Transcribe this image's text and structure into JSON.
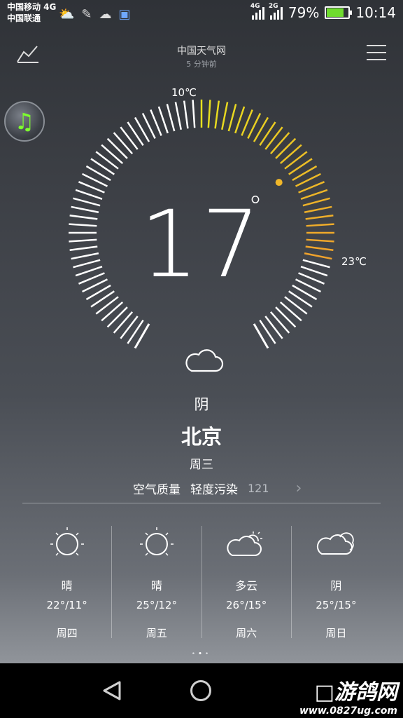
{
  "status_bar": {
    "carrier_1": "中国移动 4G",
    "carrier_2": "中国联通",
    "sig1_label": "4G",
    "sig2_label": "2G",
    "battery_pct": "79%",
    "battery_level": 0.79,
    "time": "10:14"
  },
  "header": {
    "source": "中国天气网",
    "updated": "5 分钟前"
  },
  "current": {
    "temperature": "17",
    "degree_symbol": "°",
    "low_label": "10℃",
    "high_label": "23℃",
    "low": 10,
    "high": 23,
    "condition": "阴",
    "city": "北京",
    "weekday": "周三"
  },
  "air_quality": {
    "label": "空气质量",
    "level": "轻度污染",
    "value": "121",
    "chevron": "›"
  },
  "forecast": [
    {
      "icon": "sun-icon",
      "condition": "晴",
      "range": "22°/11°",
      "day": "周四"
    },
    {
      "icon": "sun-icon",
      "condition": "晴",
      "range": "25°/12°",
      "day": "周五"
    },
    {
      "icon": "partly-cloudy-icon",
      "condition": "多云",
      "range": "26°/15°",
      "day": "周六"
    },
    {
      "icon": "cloud-icon",
      "condition": "阴",
      "range": "25°/15°",
      "day": "周日"
    }
  ],
  "watermark": {
    "title": "□游鸽网",
    "url": "www.0827ug.com"
  },
  "colors": {
    "accent_yellow": "#e7e01f",
    "accent_orange": "#f0a22c",
    "battery_green": "#6fdc2e",
    "music_green": "#7dff2e"
  }
}
